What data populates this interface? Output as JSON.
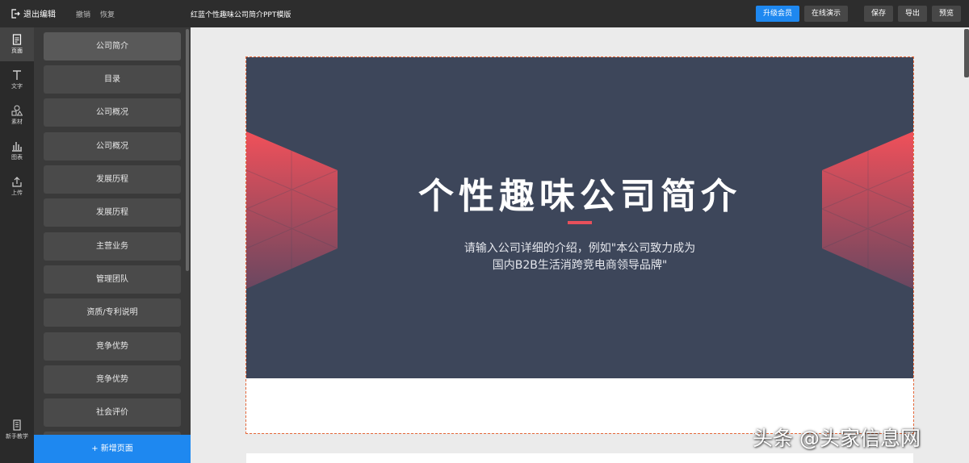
{
  "toolbar": {
    "exit_label": "退出编辑",
    "undo_label": "撤销",
    "redo_label": "恢复",
    "doc_title": "红蓝个性趣味公司简介PPT模版",
    "upgrade_label": "升级会员",
    "present_label": "在线演示",
    "save_label": "保存",
    "export_label": "导出",
    "preview_label": "预览"
  },
  "rail": {
    "items": [
      {
        "label": "页面",
        "icon": "page-icon"
      },
      {
        "label": "文字",
        "icon": "text-icon"
      },
      {
        "label": "素材",
        "icon": "shapes-icon"
      },
      {
        "label": "图表",
        "icon": "chart-icon"
      },
      {
        "label": "上传",
        "icon": "upload-icon"
      }
    ],
    "tutorial_label": "新手教学"
  },
  "pages": [
    {
      "label": "公司简介"
    },
    {
      "label": "目录"
    },
    {
      "label": "公司概况"
    },
    {
      "label": "公司概况"
    },
    {
      "label": "发展历程"
    },
    {
      "label": "发展历程"
    },
    {
      "label": "主营业务"
    },
    {
      "label": "管理团队"
    },
    {
      "label": "资质/专利说明"
    },
    {
      "label": "竞争优势"
    },
    {
      "label": "竞争优势"
    },
    {
      "label": "社会评价"
    }
  ],
  "add_page_label": "+ 新增页面",
  "slide": {
    "title": "个性趣味公司简介",
    "subtitle_line1": "请输入公司详细的介绍，例如\"本公司致力成为",
    "subtitle_line2": "国内B2B生活消跨竞电商领导品牌\"",
    "bg_color": "#3d465a",
    "accent_color": "#e8505b"
  },
  "watermark": "头条 @头家信息网",
  "colors": {
    "primary": "#1e88f0",
    "topbar": "#2d2d2d"
  }
}
